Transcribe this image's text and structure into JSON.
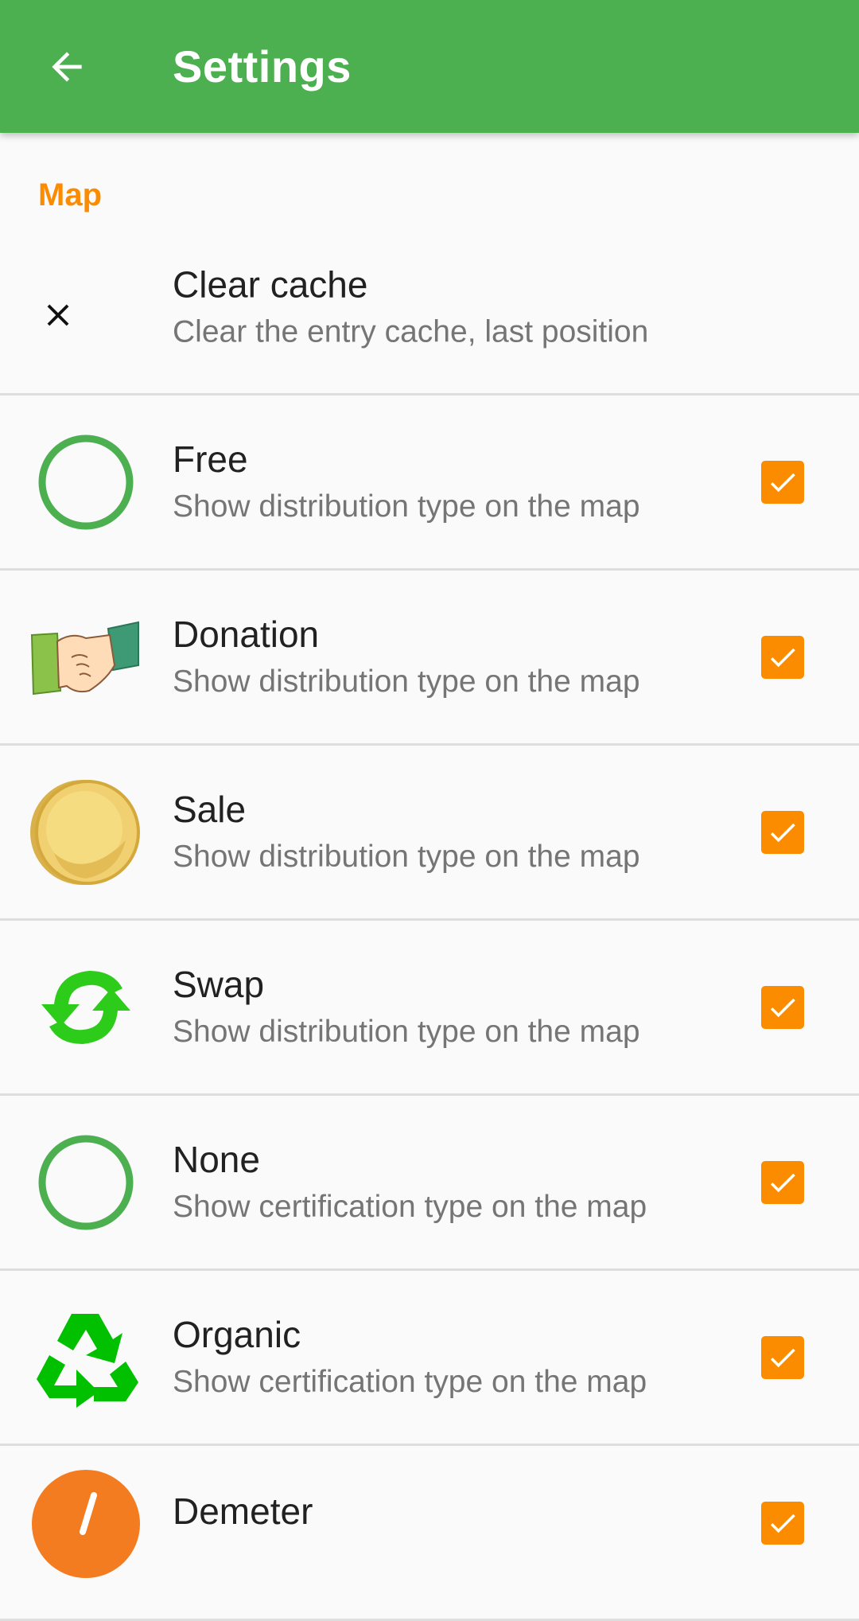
{
  "appbar": {
    "title": "Settings",
    "back_icon": "arrow-back-icon",
    "color": "#4caf50"
  },
  "section": {
    "header": "Map",
    "accent_color": "#fb8c00"
  },
  "clear_cache": {
    "icon": "close-icon",
    "title": "Clear cache",
    "summary": "Clear the entry cache, last position"
  },
  "prefs": [
    {
      "icon": "green-circle-icon",
      "title": "Free",
      "summary": "Show distribution type on the map",
      "checked": true
    },
    {
      "icon": "handshake-icon",
      "title": "Donation",
      "summary": "Show distribution type on the map",
      "checked": true
    },
    {
      "icon": "gold-coin-icon",
      "title": "Sale",
      "summary": "Show distribution type on the map",
      "checked": true
    },
    {
      "icon": "swap-arrows-icon",
      "title": "Swap",
      "summary": "Show distribution type on the map",
      "checked": true
    },
    {
      "icon": "green-circle-icon",
      "title": "None",
      "summary": "Show certification type on the map",
      "checked": true
    },
    {
      "icon": "recycle-icon",
      "title": "Organic",
      "summary": "Show certification type on the map",
      "checked": true
    },
    {
      "icon": "demeter-icon",
      "title": "Demeter",
      "summary": "",
      "checked": true
    }
  ]
}
